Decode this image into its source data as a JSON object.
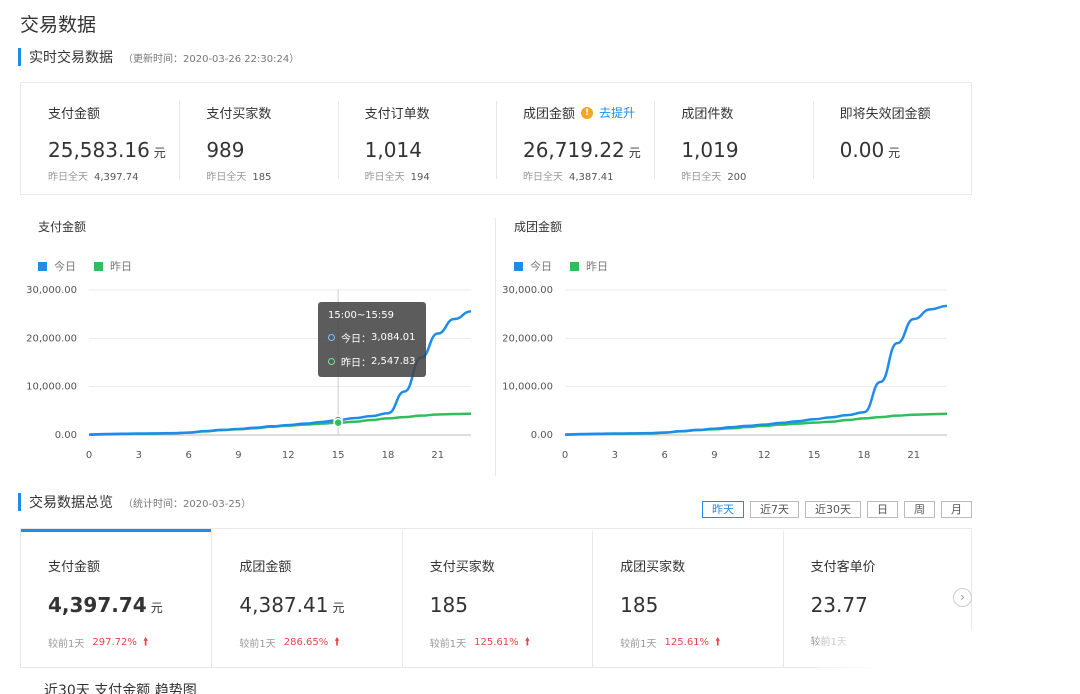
{
  "page": {
    "title": "交易数据"
  },
  "realtime": {
    "title": "实时交易数据",
    "update_note": "（更新时间：2020-03-26 22:30:24）",
    "stats": [
      {
        "label": "支付金额",
        "value": "25,583.16",
        "unit": "元",
        "yesterday_label": "昨日全天",
        "yesterday_value": "4,397.74"
      },
      {
        "label": "支付买家数",
        "value": "989",
        "unit": "",
        "yesterday_label": "昨日全天",
        "yesterday_value": "185"
      },
      {
        "label": "支付订单数",
        "value": "1,014",
        "unit": "",
        "yesterday_label": "昨日全天",
        "yesterday_value": "194"
      },
      {
        "label": "成团金额",
        "value": "26,719.22",
        "unit": "元",
        "yesterday_label": "昨日全天",
        "yesterday_value": "4,387.41",
        "link": "去提升",
        "warn_icon": "!"
      },
      {
        "label": "成团件数",
        "value": "1,019",
        "unit": "",
        "yesterday_label": "昨日全天",
        "yesterday_value": "200"
      },
      {
        "label": "即将失效团金额",
        "value": "0.00",
        "unit": "元",
        "yesterday_label": "",
        "yesterday_value": ""
      }
    ]
  },
  "legend": {
    "today": "今日",
    "yesterday": "昨日"
  },
  "colors": {
    "today": "#1f8ceb",
    "yesterday": "#2fbf5a",
    "accent": "#1f8ceb",
    "up": "#e64545"
  },
  "tooltip": {
    "title": "15:00~15:59",
    "today_label": "今日：",
    "today_value": "3,084.01",
    "yesterday_label": "昨日：",
    "yesterday_value": "2,547.83"
  },
  "chart_data": [
    {
      "type": "line",
      "title": "支付金额",
      "x": [
        0,
        1,
        2,
        3,
        4,
        5,
        6,
        7,
        8,
        9,
        10,
        11,
        12,
        13,
        14,
        15,
        16,
        17,
        18,
        19,
        20,
        21,
        22,
        23
      ],
      "xticks": [
        0,
        3,
        6,
        9,
        12,
        15,
        18,
        21
      ],
      "ylim": [
        0,
        30000
      ],
      "yticks": [
        "0.00",
        "10,000.00",
        "20,000.00",
        "30,000.00"
      ],
      "yticks_values": [
        0,
        10000,
        20000,
        30000
      ],
      "series": [
        {
          "name": "今日",
          "x": [
            0,
            1,
            2,
            3,
            4,
            5,
            6,
            7,
            8,
            9,
            10,
            11,
            12,
            13,
            14,
            15,
            16,
            17,
            18,
            19,
            20,
            21,
            22,
            23
          ],
          "values": [
            100,
            200,
            250,
            300,
            330,
            380,
            500,
            800,
            1050,
            1250,
            1500,
            1800,
            2050,
            2350,
            2700,
            3084,
            3500,
            3900,
            4500,
            9000,
            16000,
            21000,
            24000,
            25583
          ]
        },
        {
          "name": "昨日",
          "x": [
            0,
            1,
            2,
            3,
            4,
            5,
            6,
            7,
            8,
            9,
            10,
            11,
            12,
            13,
            14,
            15,
            16,
            17,
            18,
            19,
            20,
            21,
            22,
            23
          ],
          "values": [
            50,
            120,
            200,
            250,
            280,
            330,
            480,
            750,
            1000,
            1200,
            1400,
            1700,
            1950,
            2150,
            2350,
            2548,
            2750,
            3100,
            3450,
            3700,
            4000,
            4250,
            4350,
            4398
          ]
        }
      ],
      "grid": true,
      "legend_position": "top-left"
    },
    {
      "type": "line",
      "title": "成团金额",
      "x": [
        0,
        1,
        2,
        3,
        4,
        5,
        6,
        7,
        8,
        9,
        10,
        11,
        12,
        13,
        14,
        15,
        16,
        17,
        18,
        19,
        20,
        21,
        22,
        23
      ],
      "xticks": [
        0,
        3,
        6,
        9,
        12,
        15,
        18,
        21
      ],
      "ylim": [
        0,
        30000
      ],
      "yticks": [
        "0.00",
        "10,000.00",
        "20,000.00",
        "30,000.00"
      ],
      "yticks_values": [
        0,
        10000,
        20000,
        30000
      ],
      "series": [
        {
          "name": "今日",
          "x": [
            0,
            1,
            2,
            3,
            4,
            5,
            6,
            7,
            8,
            9,
            10,
            11,
            12,
            13,
            14,
            15,
            16,
            17,
            18,
            19,
            20,
            21,
            22,
            23
          ],
          "values": [
            100,
            200,
            250,
            300,
            330,
            380,
            520,
            800,
            1050,
            1300,
            1600,
            1900,
            2150,
            2500,
            2850,
            3250,
            3650,
            4100,
            4700,
            11000,
            19000,
            24000,
            26000,
            26719
          ]
        },
        {
          "name": "昨日",
          "x": [
            0,
            1,
            2,
            3,
            4,
            5,
            6,
            7,
            8,
            9,
            10,
            11,
            12,
            13,
            14,
            15,
            16,
            17,
            18,
            19,
            20,
            21,
            22,
            23
          ],
          "values": [
            50,
            120,
            200,
            250,
            280,
            330,
            470,
            750,
            1000,
            1200,
            1400,
            1650,
            1900,
            2150,
            2350,
            2550,
            2750,
            3100,
            3450,
            3700,
            4000,
            4200,
            4300,
            4387
          ]
        }
      ],
      "grid": true,
      "legend_position": "top-left"
    }
  ],
  "overview": {
    "title": "交易数据总览",
    "stat_note": "（统计时间：2020-03-25）",
    "ranges": [
      "昨天",
      "近7天",
      "近30天",
      "日",
      "周",
      "月"
    ],
    "active_range": 0,
    "items": [
      {
        "label": "支付金额",
        "value": "4,397.74",
        "unit": "元",
        "cmp_label": "较前1天",
        "cmp_value": "297.72%"
      },
      {
        "label": "成团金额",
        "value": "4,387.41",
        "unit": "元",
        "cmp_label": "较前1天",
        "cmp_value": "286.65%"
      },
      {
        "label": "支付买家数",
        "value": "185",
        "unit": "",
        "cmp_label": "较前1天",
        "cmp_value": "125.61%"
      },
      {
        "label": "成团买家数",
        "value": "185",
        "unit": "",
        "cmp_label": "较前1天",
        "cmp_value": "125.61%"
      },
      {
        "label": "支付客单价",
        "value": "23.77",
        "unit": "",
        "cmp_label": "较前1天",
        "cmp_value": ""
      }
    ],
    "trend_title": "近30天 支付金额 趋势图"
  }
}
